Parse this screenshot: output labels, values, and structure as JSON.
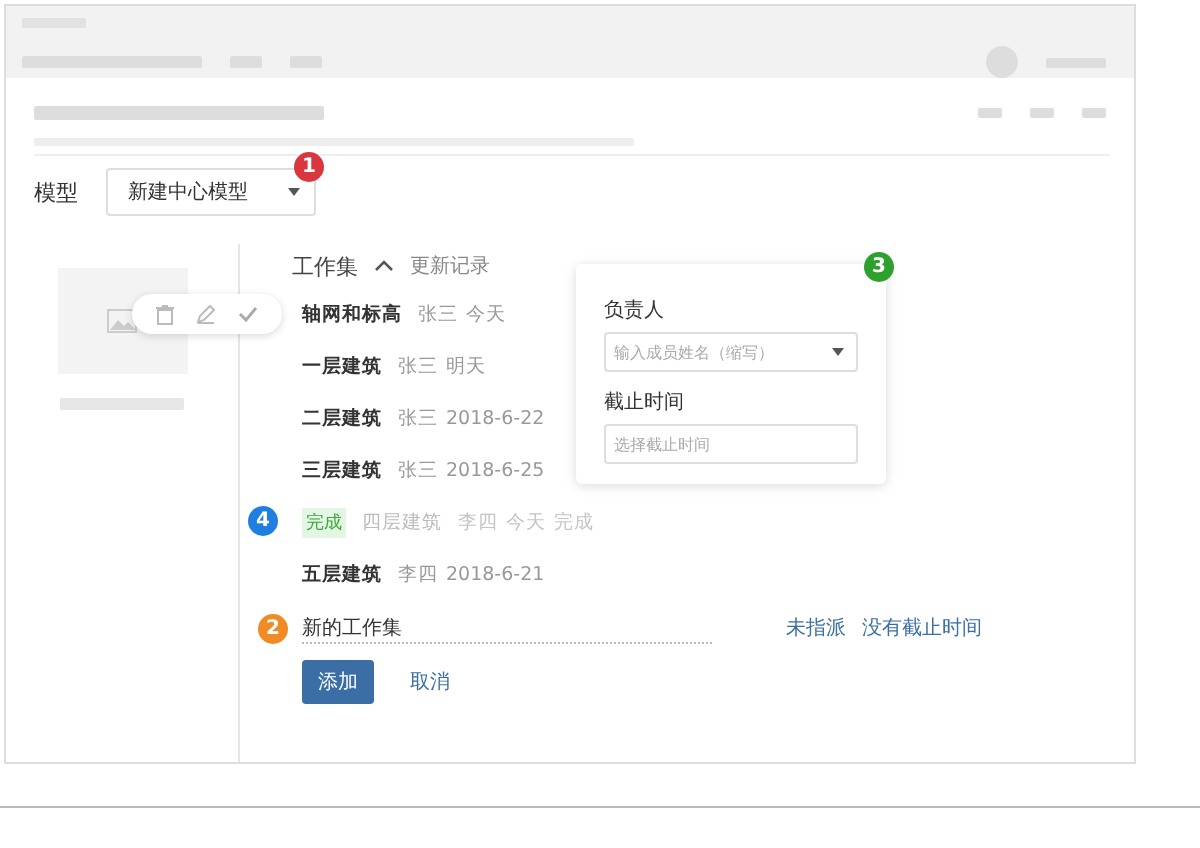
{
  "model": {
    "label": "模型",
    "value": "新建中心模型",
    "badge": {
      "number": "1",
      "color": "#d9363e"
    }
  },
  "workset": {
    "title": "工作集",
    "expanded": true,
    "history_link": "更新记录",
    "items": [
      {
        "name": "轴网和标高",
        "assignee": "张三",
        "due": "今天",
        "done": false,
        "toolbar": true
      },
      {
        "name": "一层建筑",
        "assignee": "张三",
        "due": "明天",
        "done": false
      },
      {
        "name": "二层建筑",
        "assignee": "张三",
        "due": "2018-6-22",
        "done": false
      },
      {
        "name": "三层建筑",
        "assignee": "张三",
        "due": "2018-6-25",
        "done": false
      },
      {
        "name": "四层建筑",
        "assignee": "李四",
        "due": "今天",
        "done": true,
        "tag": "完成",
        "note": "完成",
        "badge": {
          "number": "4",
          "color": "#1e7fe0"
        }
      },
      {
        "name": "五层建筑",
        "assignee": "李四",
        "due": "2018-6-21",
        "done": false
      }
    ],
    "new_item": {
      "value": "新的工作集",
      "assignee": "未指派",
      "due": "没有截止时间",
      "badge": {
        "number": "2",
        "color": "#f08a24"
      }
    },
    "buttons": [
      {
        "label": "添加",
        "kind": "primary"
      },
      {
        "label": "取消",
        "kind": "link"
      }
    ]
  },
  "popover": {
    "badge": {
      "number": "3",
      "color": "#2ea02e"
    },
    "fields": [
      {
        "label": "负责人",
        "placeholder": "输入成员姓名（缩写）",
        "kind": "select"
      },
      {
        "label": "截止时间",
        "placeholder": "选择截止时间",
        "kind": "input"
      }
    ]
  }
}
